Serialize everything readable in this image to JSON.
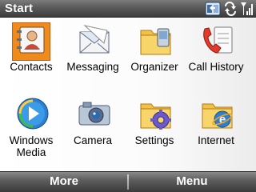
{
  "title": "Start",
  "status_icons": [
    "sync-icon",
    "data-connection-icon",
    "signal-strength-icon"
  ],
  "apps": [
    {
      "label": "Contacts",
      "icon": "contacts-icon",
      "selected": true
    },
    {
      "label": "Messaging",
      "icon": "messaging-icon"
    },
    {
      "label": "Organizer",
      "icon": "organizer-icon"
    },
    {
      "label": "Call History",
      "icon": "call-history-icon"
    },
    {
      "label": "Windows\nMedia",
      "icon": "windows-media-icon"
    },
    {
      "label": "Camera",
      "icon": "camera-icon"
    },
    {
      "label": "Settings",
      "icon": "settings-icon"
    },
    {
      "label": "Internet",
      "icon": "internet-icon"
    }
  ],
  "softkeys": {
    "left": "More",
    "right": "Menu"
  },
  "colors": {
    "selection": "#ef8a1c",
    "bar_dark": "#3c3c3c",
    "bar_light": "#8a8a8a"
  }
}
